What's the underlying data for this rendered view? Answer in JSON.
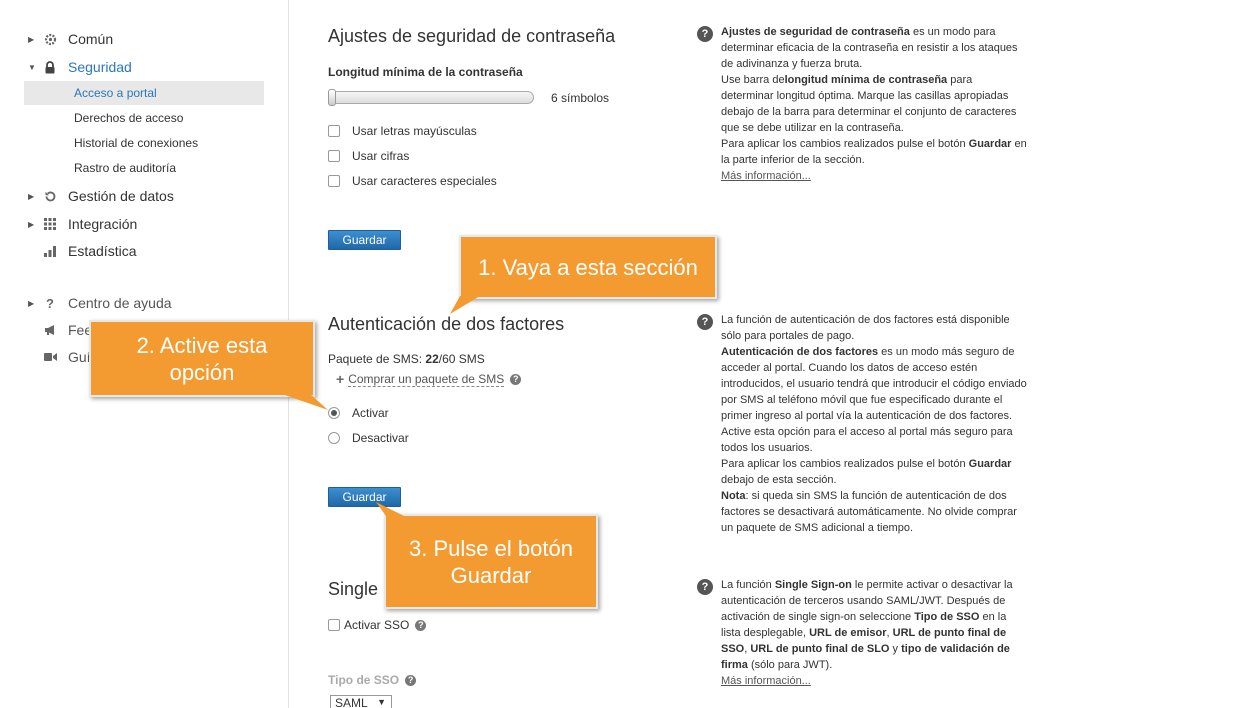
{
  "sidebar": {
    "items": [
      {
        "label": "Común",
        "icon": "gear-icon"
      },
      {
        "label": "Seguridad",
        "icon": "lock-icon"
      },
      {
        "label": "Gestión de datos",
        "icon": "restore-icon"
      },
      {
        "label": "Integración",
        "icon": "grid-icon"
      },
      {
        "label": "Estadística",
        "icon": "bar-chart-icon"
      },
      {
        "label": "Centro de ayuda",
        "icon": "question-icon"
      },
      {
        "label": "Fee",
        "icon": "megaphone-icon"
      },
      {
        "label": "Guí",
        "icon": "video-icon"
      }
    ],
    "security_sub": [
      {
        "label": "Acceso a portal"
      },
      {
        "label": "Derechos de acceso"
      },
      {
        "label": "Historial de conexiones"
      },
      {
        "label": "Rastro de auditoría"
      }
    ]
  },
  "password": {
    "title": "Ajustes de seguridad de contraseña",
    "min_length_label": "Longitud mínima de la contraseña",
    "slider_value_text": "6 símbolos",
    "checkboxes": [
      {
        "label": "Usar letras mayúsculas",
        "checked": false
      },
      {
        "label": "Usar cifras",
        "checked": false
      },
      {
        "label": "Usar caracteres especiales",
        "checked": false
      }
    ],
    "save_label": "Guardar"
  },
  "twofa": {
    "title": "Autenticación de dos factores",
    "sms_prefix": "Paquete de SMS: ",
    "sms_used": "22",
    "sms_total": "/60 SMS",
    "buy_link": "Comprar un paquete de SMS",
    "radio_on": "Activar",
    "radio_off": "Desactivar",
    "selected": "Activar",
    "save_label": "Guardar"
  },
  "sso": {
    "title": "Single",
    "enable_label": "Activar SSO",
    "type_label": "Tipo de SSO",
    "type_value": "SAML"
  },
  "help": {
    "password": {
      "b1": "Ajustes de seguridad de contraseña",
      "t1": " es un modo para determinar eficacia de la contraseña en resistir a los ataques de adivinanza y fuerza bruta.",
      "t2": "Use barra de",
      "b2": "longitud mínima de contraseña",
      "t3": " para determinar longitud óptima. Marque las casillas apropiadas debajo de la barra para determinar el conjunto de caracteres que se debe utilizar en la contraseña.",
      "t4": "Para aplicar los cambios realizados pulse el botón ",
      "b3": "Guardar",
      "t5": " en la parte inferior de la sección.",
      "more": "Más información..."
    },
    "twofa": {
      "t1": "La función de autenticación de dos factores está disponible sólo para portales de pago.",
      "b1": "Autenticación de dos factores",
      "t2": " es un modo más seguro de acceder al portal. Cuando los datos de acceso estén introducidos, el usuario tendrá que introducir el código enviado por SMS al teléfono móvil que fue especificado durante el primer ingreso al portal vía la autenticación de dos factores.",
      "t3": "Active esta opción para el acceso al portal más seguro para todos los usuarios.",
      "t4": "Para aplicar los cambios realizados pulse el botón ",
      "b2": "Guardar",
      "t5": " debajo de esta sección.",
      "b3": "Nota",
      "t6": ": si queda sin SMS la función de autenticación de dos factores se desactivará automáticamente. No olvide comprar un paquete de SMS adicional a tiempo."
    },
    "sso": {
      "t1": "La función ",
      "b1": "Single Sign-on",
      "t2": " le permite activar o desactivar la autenticación de terceros usando SAML/JWT. Después de activación de single sign-on seleccione ",
      "b2": "Tipo de SSO",
      "t3": " en la lista desplegable, ",
      "b3": "URL de emisor",
      "t4": ", ",
      "b4": "URL de punto final de SSO",
      "t5": ", ",
      "b5": "URL de punto final de SLO",
      "t6": " y ",
      "b6": "tipo de validación de firma",
      "t7": " (sólo para JWT).",
      "more": "Más información..."
    }
  },
  "callouts": {
    "c1": "1. Vaya a esta sección",
    "c2a": "2. Active esta",
    "c2b": "opción",
    "c3a": "3. Pulse el botón",
    "c3b": "Guardar"
  },
  "colors": {
    "accent": "#2b78b9",
    "callout": "#f39a30",
    "button": "#2a78bd"
  }
}
